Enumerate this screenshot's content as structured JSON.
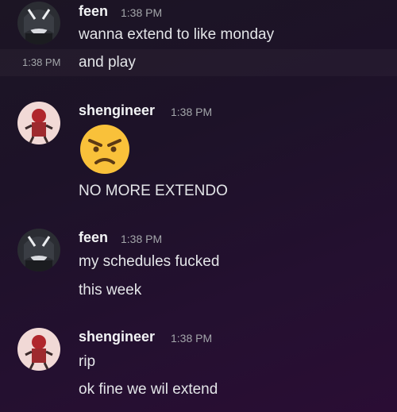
{
  "messages": [
    {
      "author": "feen",
      "timestamp": "1:38 PM",
      "avatar": "feen-avatar",
      "lines": [
        "wanna extend to like monday"
      ],
      "continuation": {
        "timestamp": "1:38 PM",
        "text": "and play"
      }
    },
    {
      "author": "shengineer",
      "timestamp": "1:38 PM",
      "avatar": "shengineer-avatar",
      "emoji": "angry-face-emoji",
      "lines": [
        "NO MORE EXTENDO"
      ]
    },
    {
      "author": "feen",
      "timestamp": "1:38 PM",
      "avatar": "feen-avatar",
      "lines": [
        "my schedules fucked",
        "this week"
      ]
    },
    {
      "author": "shengineer",
      "timestamp": "1:38 PM",
      "avatar": "shengineer-avatar",
      "lines": [
        "rip",
        "ok fine we wil extend"
      ]
    }
  ]
}
